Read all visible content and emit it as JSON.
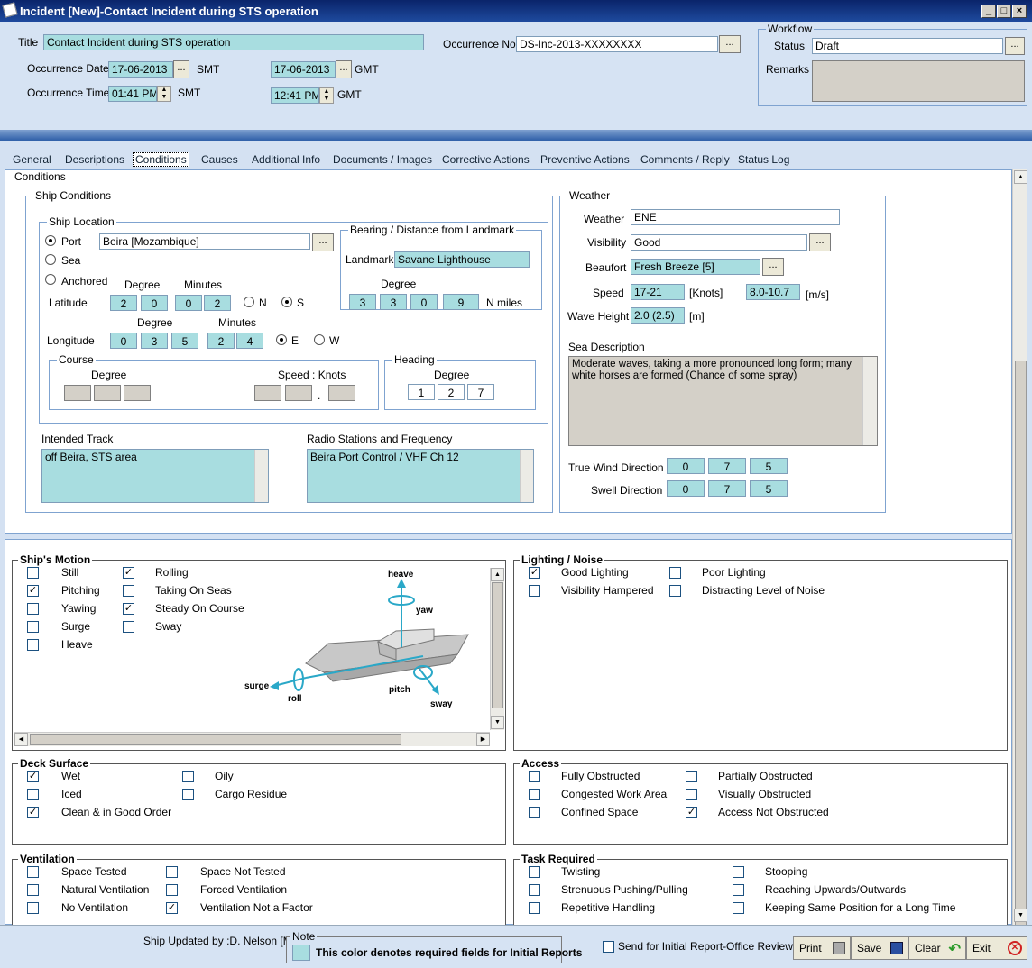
{
  "window": {
    "title": "Incident   [New]-Contact Incident during STS operation"
  },
  "header": {
    "title_label": "Title",
    "title_value": "Contact Incident during STS operation",
    "occurrence_no_label": "Occurrence No.",
    "occurrence_no_value": "DS-Inc-2013-XXXXXXXX",
    "date_label": "Occurrence Date",
    "date_smt": "17-06-2013",
    "smt1": "SMT",
    "date_gmt": "17-06-2013",
    "gmt1": "GMT",
    "time_label": "Occurrence Time",
    "time_smt": "01:41 PM",
    "smt2": "SMT",
    "time_gmt": "12:41 PM",
    "gmt2": "GMT",
    "dots": "..."
  },
  "workflow": {
    "legend": "Workflow",
    "status_label": "Status",
    "status_value": "Draft",
    "remarks_label": "Remarks"
  },
  "tabs": [
    "General",
    "Descriptions",
    "Conditions",
    "Causes",
    "Additional Info",
    "Documents / Images",
    "Corrective Actions",
    "Preventive Actions",
    "Comments / Reply",
    "Status Log"
  ],
  "conditions": {
    "legend": "Conditions",
    "ship_conditions": "Ship Conditions",
    "ship_location": "Ship Location",
    "port": "Port",
    "sea": "Sea",
    "anchored": "Anchored",
    "port_value": "Beira   [Mozambique]",
    "degree": "Degree",
    "minutes": "Minutes",
    "latitude": "Latitude",
    "lat": [
      "2",
      "0",
      "0",
      "2"
    ],
    "n": "N",
    "s": "S",
    "longitude": "Longitude",
    "lon": [
      "0",
      "3",
      "5",
      "2",
      "4"
    ],
    "e": "E",
    "w": "W",
    "bearing": "Bearing / Distance from Landmark",
    "landmark_label": "Landmark",
    "landmark_value": "Savane Lighthouse",
    "bearing_degree": "Degree",
    "bearing_vals": [
      "3",
      "3",
      "0",
      "9"
    ],
    "nmiles": "N miles",
    "course": "Course",
    "course_degree": "Degree",
    "speed_knots": "Speed : Knots",
    "dot": ".",
    "heading": "Heading",
    "heading_degree": "Degree",
    "heading_vals": [
      "1",
      "2",
      "7"
    ],
    "intended_track": "Intended Track",
    "intended_track_value": "off Beira, STS area",
    "radio": "Radio Stations and Frequency",
    "radio_value": "Beira Port Control / VHF Ch 12"
  },
  "weather": {
    "legend": "Weather",
    "weather_label": "Weather",
    "weather_value": "ENE",
    "visibility_label": "Visibility",
    "visibility_value": "Good",
    "beaufort_label": "Beaufort",
    "beaufort_value": "Fresh Breeze   [5]",
    "speed_label": "Speed",
    "speed_knots": "17-21",
    "knots": "[Knots]",
    "speed_ms": "8.0-10.7",
    "ms": "[m/s]",
    "wave_label": "Wave Height",
    "wave_value": "2.0 (2.5)",
    "m": "[m]",
    "sea_desc_label": "Sea Description",
    "sea_desc": "Moderate waves, taking a more pronounced long form; many white horses are formed (Chance of some spray)",
    "true_wind_label": "True Wind Direction",
    "true_wind": [
      "0",
      "7",
      "5"
    ],
    "swell_label": "Swell Direction",
    "swell": [
      "0",
      "7",
      "5"
    ]
  },
  "motion": {
    "legend": "Ship's Motion",
    "items": [
      {
        "label": "Still",
        "checked": false
      },
      {
        "label": "Pitching",
        "checked": true
      },
      {
        "label": "Yawing",
        "checked": false
      },
      {
        "label": "Surge",
        "checked": false
      },
      {
        "label": "Heave",
        "checked": false
      },
      {
        "label": "Rolling",
        "checked": true
      },
      {
        "label": "Taking On Seas",
        "checked": false
      },
      {
        "label": "Steady On Course",
        "checked": true
      },
      {
        "label": "Sway",
        "checked": false
      }
    ],
    "diagram": {
      "heave": "heave",
      "yaw": "yaw",
      "surge": "surge",
      "roll": "roll",
      "pitch": "pitch",
      "sway": "sway"
    }
  },
  "lighting": {
    "legend": "Lighting / Noise",
    "items": [
      {
        "label": "Good Lighting",
        "checked": true
      },
      {
        "label": "Visibility Hampered",
        "checked": false
      },
      {
        "label": "Poor Lighting",
        "checked": false
      },
      {
        "label": "Distracting Level of Noise",
        "checked": false
      }
    ]
  },
  "deck": {
    "legend": "Deck Surface",
    "items": [
      {
        "label": "Wet",
        "checked": true
      },
      {
        "label": "Iced",
        "checked": false
      },
      {
        "label": "Clean & in Good Order",
        "checked": true
      },
      {
        "label": "Oily",
        "checked": false
      },
      {
        "label": "Cargo Residue",
        "checked": false
      }
    ]
  },
  "access": {
    "legend": "Access",
    "items": [
      {
        "label": "Fully Obstructed",
        "checked": false
      },
      {
        "label": "Congested Work Area",
        "checked": false
      },
      {
        "label": "Confined Space",
        "checked": false
      },
      {
        "label": "Partially Obstructed",
        "checked": false
      },
      {
        "label": "Visually Obstructed",
        "checked": false
      },
      {
        "label": "Access Not Obstructed",
        "checked": true
      }
    ]
  },
  "ventilation": {
    "legend": "Ventilation",
    "items": [
      {
        "label": "Space Tested",
        "checked": false
      },
      {
        "label": "Natural Ventilation",
        "checked": false
      },
      {
        "label": "No Ventilation",
        "checked": false
      },
      {
        "label": "Space Not Tested",
        "checked": false
      },
      {
        "label": "Forced Ventilation",
        "checked": false
      },
      {
        "label": "Ventilation Not a Factor",
        "checked": true
      }
    ]
  },
  "task": {
    "legend": "Task Required",
    "items": [
      {
        "label": "Twisting",
        "checked": false
      },
      {
        "label": "Strenuous Pushing/Pulling",
        "checked": false
      },
      {
        "label": "Repetitive Handling",
        "checked": false
      },
      {
        "label": "Stooping",
        "checked": false
      },
      {
        "label": "Reaching Upwards/Outwards",
        "checked": false
      },
      {
        "label": "Keeping Same Position for a Long Time",
        "checked": false
      }
    ]
  },
  "footer": {
    "updated": "Ship Updated by :D. Nelson   [M",
    "note_legend": "Note",
    "note_text": "This color denotes required fields for Initial Reports",
    "send_label": "Send for Initial Report-Office Review",
    "print": "Print",
    "save": "Save",
    "clear": "Clear",
    "exit": "Exit"
  },
  "colors": {
    "required": "#a8dde0",
    "accent": "#0a246a"
  }
}
